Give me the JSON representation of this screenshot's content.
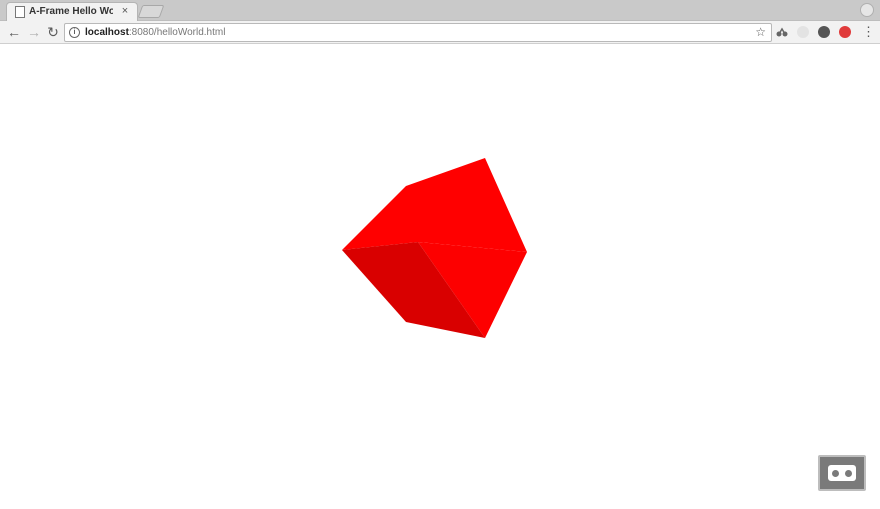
{
  "browser": {
    "tab_title": "A-Frame Hello World",
    "tab_close": "×",
    "url_host": "localhost",
    "url_rest": ":8080/helloWorld.html",
    "info_glyph": "i",
    "star_glyph": "☆",
    "back_glyph": "←",
    "forward_glyph": "→",
    "reload_glyph": "↻",
    "menu_glyph": "⋮",
    "icons": [
      "page-icon",
      "close-icon",
      "info-icon",
      "star-icon",
      "back-icon",
      "forward-icon",
      "reload-icon",
      "extension-icon",
      "menu-icon"
    ]
  },
  "scene": {
    "object": "box",
    "colors": {
      "top": "#ff0000",
      "right": "#fd0000",
      "left": "#d90000",
      "background": "#ffffff"
    }
  },
  "vr_button": {
    "icon": "vr-headset-icon"
  }
}
